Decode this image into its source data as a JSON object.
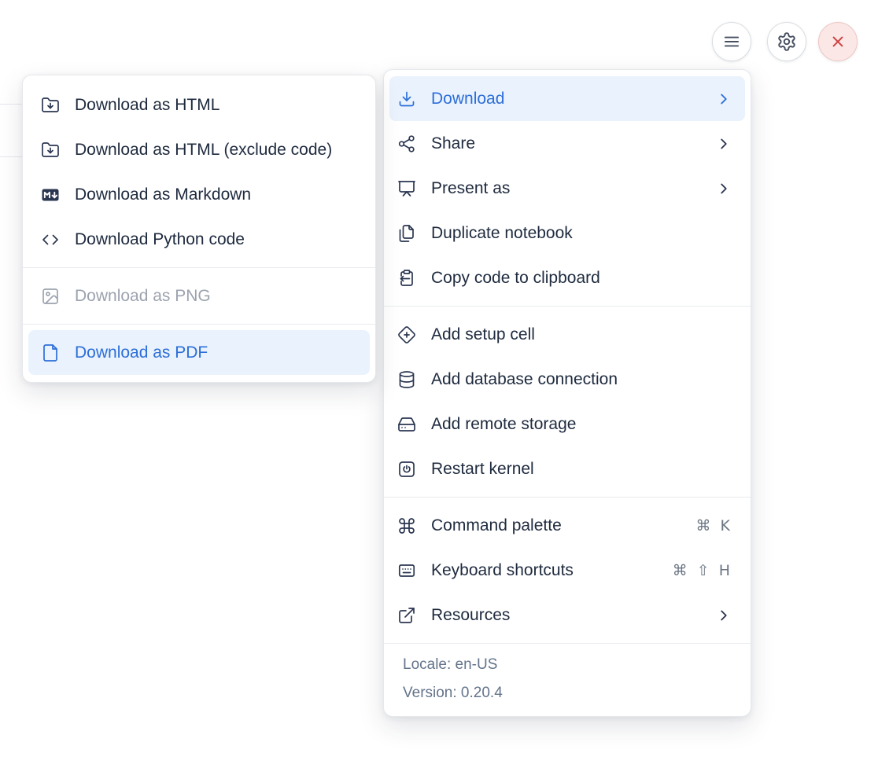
{
  "colors": {
    "accent_blue": "#2d6ed8",
    "highlight_bg": "#e9f2fd",
    "text_dark": "#1e2a3e",
    "muted_gray": "#64748b",
    "disabled_gray": "#9ca3af",
    "danger_red": "#cf4040",
    "danger_bg": "#fbe7e6",
    "danger_border": "#eec7c4"
  },
  "toolbar": {
    "menu_button": {
      "icon": "hamburger-icon"
    },
    "settings_button": {
      "icon": "gear-icon"
    },
    "close_button": {
      "icon": "x-icon"
    }
  },
  "download_submenu": {
    "items": [
      {
        "label": "Download as HTML",
        "icon": "folder-down-icon",
        "state": "normal"
      },
      {
        "label": "Download as HTML (exclude code)",
        "icon": "folder-down-icon",
        "state": "normal"
      },
      {
        "label": "Download as Markdown",
        "icon": "markdown-icon",
        "state": "normal"
      },
      {
        "label": "Download Python code",
        "icon": "code-icon",
        "state": "normal"
      },
      {
        "label": "Download as PNG",
        "icon": "image-icon",
        "state": "disabled"
      },
      {
        "label": "Download as PDF",
        "icon": "file-icon",
        "state": "highlighted"
      }
    ]
  },
  "main_menu": {
    "items": [
      {
        "label": "Download",
        "icon": "download-icon",
        "state": "highlighted",
        "has_submenu": true
      },
      {
        "label": "Share",
        "icon": "share-icon",
        "has_submenu": true
      },
      {
        "label": "Present as",
        "icon": "presentation-icon",
        "has_submenu": true
      },
      {
        "label": "Duplicate notebook",
        "icon": "duplicate-icon"
      },
      {
        "label": "Copy code to clipboard",
        "icon": "clipboard-copy-icon"
      },
      {
        "label": "Add setup cell",
        "icon": "diamond-plus-icon"
      },
      {
        "label": "Add database connection",
        "icon": "database-icon"
      },
      {
        "label": "Add remote storage",
        "icon": "hard-drive-icon"
      },
      {
        "label": "Restart kernel",
        "icon": "power-icon"
      },
      {
        "label": "Command palette",
        "icon": "command-icon",
        "shortcut": "⌘ K"
      },
      {
        "label": "Keyboard shortcuts",
        "icon": "keyboard-icon",
        "shortcut": "⌘ ⇧ H"
      },
      {
        "label": "Resources",
        "icon": "external-link-icon",
        "has_submenu": true
      }
    ],
    "footer": {
      "locale": "Locale: en-US",
      "version": "Version: 0.20.4"
    }
  }
}
